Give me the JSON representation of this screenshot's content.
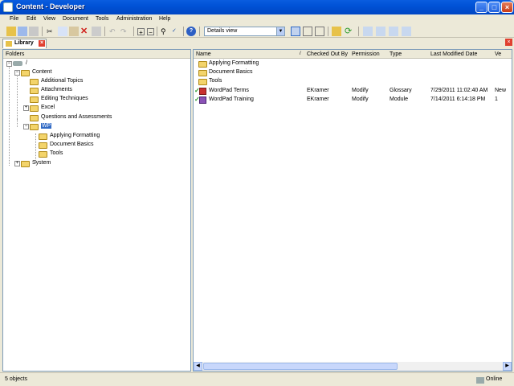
{
  "window": {
    "title": "Content - Developer"
  },
  "menu": [
    "File",
    "Edit",
    "View",
    "Document",
    "Tools",
    "Administration",
    "Help"
  ],
  "toolbar": {
    "view_select": "Details view"
  },
  "tabs": {
    "library": "Library"
  },
  "left": {
    "header": "Folders",
    "tree": [
      {
        "label": "/"
      },
      {
        "label": "Content"
      },
      {
        "label": "Additional Topics"
      },
      {
        "label": "Attachments"
      },
      {
        "label": "Editing Techniques"
      },
      {
        "label": "Excel"
      },
      {
        "label": "Questions and Assessments"
      },
      {
        "label": "WP"
      },
      {
        "label": "Applying Formatting"
      },
      {
        "label": "Document Basics"
      },
      {
        "label": "Tools"
      },
      {
        "label": "System"
      }
    ]
  },
  "right": {
    "columns": [
      "Name",
      "Checked Out By",
      "Permission",
      "Type",
      "Last Modified Date",
      "Ve"
    ],
    "rows": [
      {
        "name": "Applying Formatting",
        "checked": "",
        "perm": "",
        "type": "",
        "date": "",
        "ver": ""
      },
      {
        "name": "Document Basics",
        "checked": "",
        "perm": "",
        "type": "",
        "date": "",
        "ver": ""
      },
      {
        "name": "Tools",
        "checked": "",
        "perm": "",
        "type": "",
        "date": "",
        "ver": ""
      },
      {
        "name": "WordPad Terms",
        "checked": "EKramer",
        "perm": "Modify",
        "type": "Glossary",
        "date": "7/29/2011 11:02:40 AM",
        "ver": "New"
      },
      {
        "name": "WordPad Training",
        "checked": "EKramer",
        "perm": "Modify",
        "type": "Module",
        "date": "7/14/2011 6:14:18 PM",
        "ver": "1"
      }
    ]
  },
  "status": {
    "left": "5 objects",
    "right": "Online"
  }
}
